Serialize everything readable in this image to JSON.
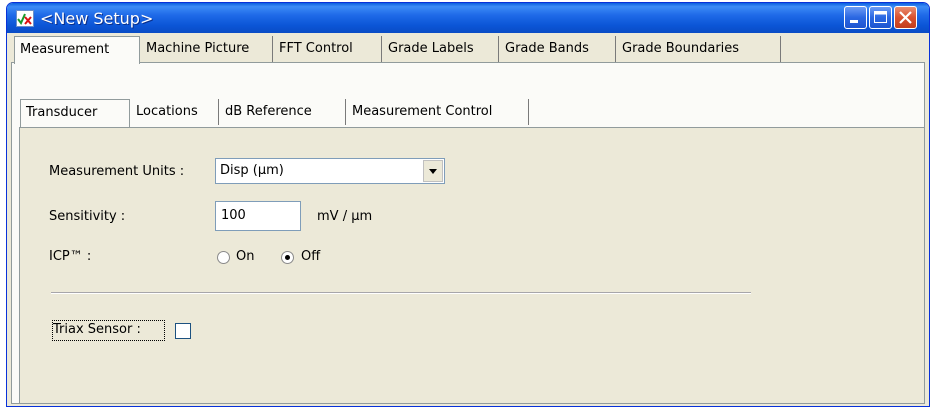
{
  "window": {
    "title": "<New Setup>",
    "icon": "app-vx-icon",
    "controls": [
      "minimize-icon",
      "maximize-icon",
      "close-icon"
    ]
  },
  "main_tabs": [
    {
      "label": "Measurement",
      "active": true
    },
    {
      "label": "Machine Picture",
      "active": false
    },
    {
      "label": "FFT Control",
      "active": false
    },
    {
      "label": "Grade Labels",
      "active": false
    },
    {
      "label": "Grade Bands",
      "active": false
    },
    {
      "label": "Grade Boundaries",
      "active": false
    }
  ],
  "sub_tabs": [
    {
      "label": "Transducer",
      "active": true
    },
    {
      "label": "Locations",
      "active": false
    },
    {
      "label": "dB Reference",
      "active": false
    },
    {
      "label": "Measurement Control",
      "active": false
    }
  ],
  "form": {
    "measurement_units_label": "Measurement Units :",
    "measurement_units_value": "Disp (µm)",
    "sensitivity_label": "Sensitivity :",
    "sensitivity_value": "100",
    "sensitivity_unit": "mV / µm",
    "icp_label": "ICP™ :",
    "icp_on_label": "On",
    "icp_off_label": "Off",
    "icp_selected": "Off",
    "triax_label": "Triax Sensor :",
    "triax_checked": false
  }
}
